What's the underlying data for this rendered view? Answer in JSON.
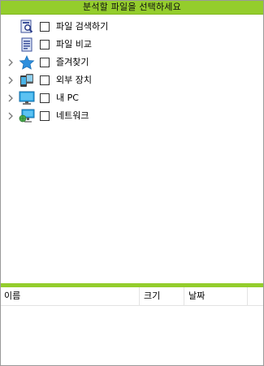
{
  "title": "분석할 파일을 선택하세요",
  "tree": {
    "items": [
      {
        "label": "파일 검색하기",
        "icon": "file-search-icon",
        "expandable": false,
        "checked": false
      },
      {
        "label": "파일 비교",
        "icon": "file-compare-icon",
        "expandable": false,
        "checked": false
      },
      {
        "label": "즐겨찾기",
        "icon": "star-icon",
        "expandable": true,
        "checked": false
      },
      {
        "label": "외부 장치",
        "icon": "devices-icon",
        "expandable": true,
        "checked": false
      },
      {
        "label": "내 PC",
        "icon": "monitor-icon",
        "expandable": true,
        "checked": false
      },
      {
        "label": "네트워크",
        "icon": "network-icon",
        "expandable": true,
        "checked": false
      }
    ]
  },
  "file_list": {
    "columns": {
      "name": "이름",
      "size": "크기",
      "date": "날짜"
    },
    "rows": []
  },
  "colors": {
    "accent": "#94cd2c",
    "border": "#9a9a9a"
  }
}
